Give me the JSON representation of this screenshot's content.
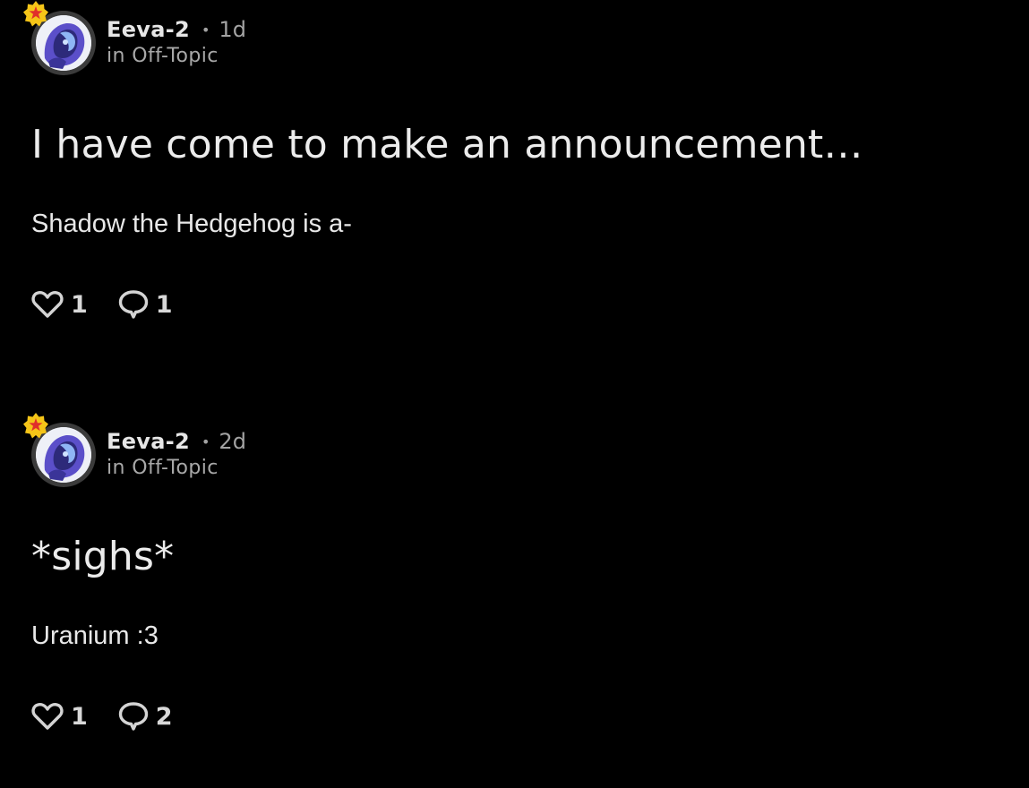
{
  "colors": {
    "background": "#000000",
    "text_primary": "#ececec",
    "text_secondary": "#a3a3a3",
    "badge_yellow": "#f5c518",
    "badge_red": "#e0302b",
    "avatar_purple": "#5b4fc9"
  },
  "posts": [
    {
      "author": "Eeva-2",
      "separator": "•",
      "time": "1d",
      "community": "in Off-Topic",
      "title": "I have come to make an announcement…",
      "body": "Shadow the Hedgehog is a-",
      "likes": "1",
      "comments": "1",
      "icons": {
        "badge": "star-badge-icon",
        "like": "heart-icon",
        "comment": "comment-bubble-icon"
      }
    },
    {
      "author": "Eeva-2",
      "separator": "•",
      "time": "2d",
      "community": "in Off-Topic",
      "title": "*sighs*",
      "body": "Uranium :3",
      "likes": "1",
      "comments": "2",
      "icons": {
        "badge": "star-badge-icon",
        "like": "heart-icon",
        "comment": "comment-bubble-icon"
      }
    }
  ]
}
